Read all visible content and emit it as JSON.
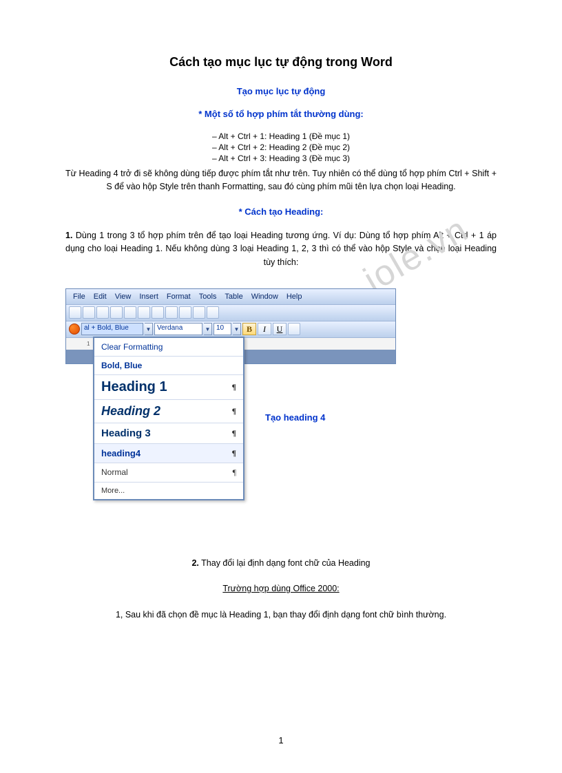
{
  "title": "Cách tạo mục lục tự động trong Word",
  "sub1": "Tạo mục lục tự động",
  "sub2": "* Một số tổ hợp phím tắt thường dùng:",
  "shortcuts": [
    "– Alt + Ctrl + 1: Heading 1 (Đề mục 1)",
    "– Alt + Ctrl + 2: Heading 2 (Đề mục 2)",
    "– Alt + Ctrl + 3: Heading 3 (Đề mục 3)"
  ],
  "para1": "Từ Heading 4 trở đi sẽ không dùng tiếp được phím tắt như trên. Tuy nhiên có thể dùng tổ hợp phím Ctrl + Shift + S để vào hộp Style trên thanh Formatting, sau đó cùng phím mũi tên lựa chọn loại Heading.",
  "sub3": "* Cách tạo Heading:",
  "para2_lead": "1.",
  "para2": " Dùng 1 trong 3 tổ hợp phím trên để tạo loại Heading tương ứng. Ví dụ: Dùng tổ hợp phím Alt + Ctrl + 1 áp dụng cho loại Heading 1. Nếu không dùng 3 loại Heading 1, 2, 3 thì có thể vào hộp Style và chọn loại Heading tùy thích:",
  "word": {
    "menu": [
      "File",
      "Edit",
      "View",
      "Insert",
      "Format",
      "Tools",
      "Table",
      "Window",
      "Help"
    ],
    "styleText": "al + Bold, Blue",
    "fontText": "Verdana",
    "sizeText": "10",
    "bold": "B",
    "italic": "I",
    "underline": "U",
    "ruler": "1 2 3 4",
    "dropdown": {
      "clear": "Clear Formatting",
      "boldblue": "Bold, Blue",
      "h1": "Heading 1",
      "h2": "Heading 2",
      "h3": "Heading 3",
      "h4": "heading4",
      "normal": "Normal",
      "more": "More..."
    }
  },
  "caption_side": "Tạo heading 4",
  "para3_lead": "2.",
  "para3": " Thay đổi lại định dạng font chữ của Heading",
  "sub4": "Trường hợp dùng Office 2000:  ",
  "para4": "1, Sau khi đã chọn đề mục là Heading 1, bạn thay đổi định dạng font chữ bình thường.",
  "watermark": "iole.vn",
  "pagenum": "1"
}
